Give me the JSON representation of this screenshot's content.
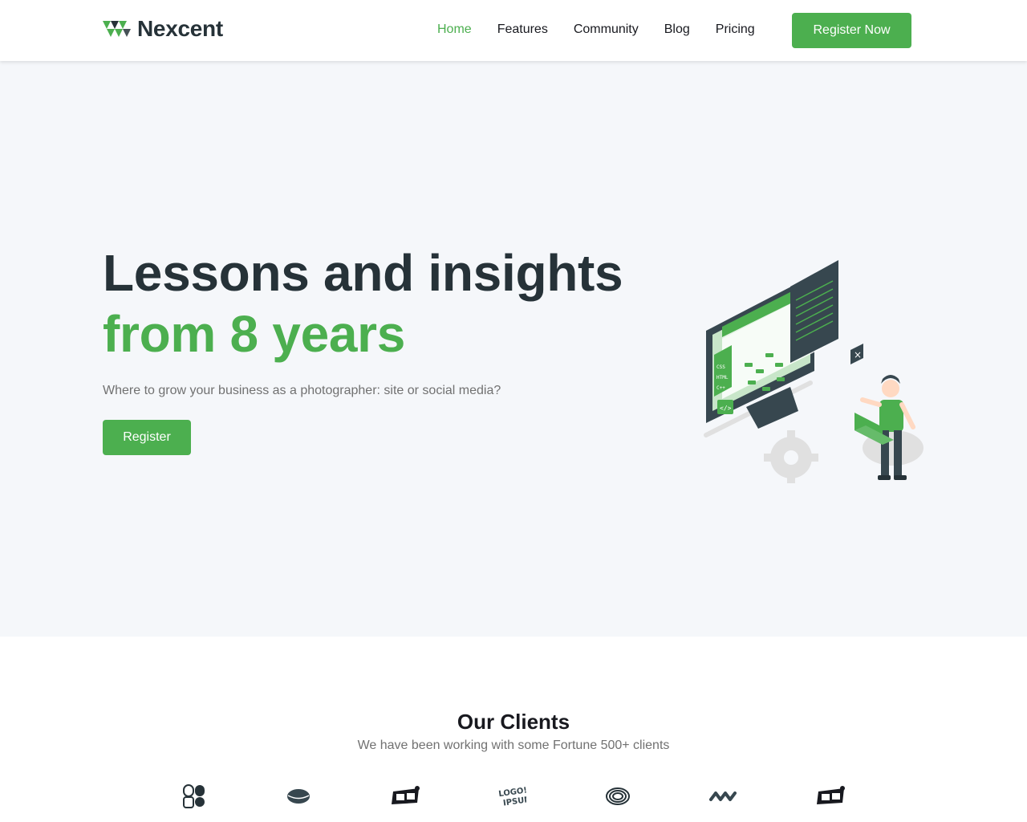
{
  "header": {
    "brand": "Nexcent",
    "logo_icon": "nexcent-logo-icon",
    "nav": [
      {
        "label": "Home",
        "active": true
      },
      {
        "label": "Features",
        "active": false
      },
      {
        "label": "Community",
        "active": false
      },
      {
        "label": "Blog",
        "active": false
      },
      {
        "label": "Pricing",
        "active": false
      }
    ],
    "cta_label": "Register Now"
  },
  "hero": {
    "title_line1": "Lessons and insights",
    "title_line2": "from 8 years",
    "subtitle": "Where to grow your business as a photographer: site or social media?",
    "button_label": "Register",
    "illustration": "developer-at-monitor-illustration"
  },
  "clients": {
    "title": "Our Clients",
    "subtitle": "We have been working with some Fortune 500+ clients",
    "logos": [
      "client-logo-1-icon",
      "client-logo-2-icon",
      "client-logo-3-icon",
      "client-logo-4-icon",
      "client-logo-5-icon",
      "client-logo-6-icon",
      "client-logo-7-icon"
    ]
  },
  "colors": {
    "primary": "#4caf4f",
    "dark": "#263238",
    "hero_bg": "#f5f7fa",
    "muted": "#717171"
  }
}
